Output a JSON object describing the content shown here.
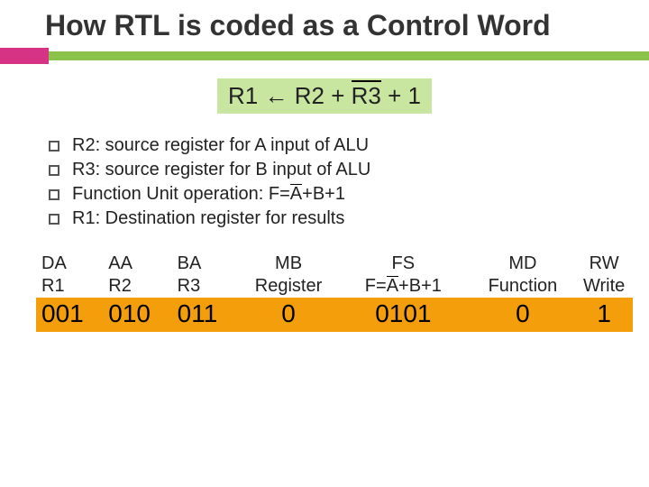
{
  "title": "How RTL is coded as a Control Word",
  "equation": {
    "lhs": "R1",
    "arrow": "←",
    "r2": "R2",
    "plus1": "+",
    "r3": "R3",
    "plus2": "+",
    "one": "1"
  },
  "bullets": {
    "b1": "R2: source register for A input of ALU",
    "b2": "R3: source register for B input of ALU",
    "b3_pre": "Function Unit operation: F=",
    "b3_a": "A",
    "b3_post": "+B+1",
    "b4": "R1: Destination register for results"
  },
  "table": {
    "headers": {
      "da": "DA",
      "aa": "AA",
      "ba": "BA",
      "mb": "MB",
      "fs": "FS",
      "md": "MD",
      "rw": "RW"
    },
    "sub": {
      "da": "R1",
      "aa": "R2",
      "ba": "R3",
      "mb": "Register",
      "fs_pre": "F=",
      "fs_a": "A",
      "fs_post": "+B+1",
      "md": "Function",
      "rw": "Write"
    },
    "codes": {
      "da": "001",
      "aa": "010",
      "ba": "011",
      "mb": "0",
      "fs": "0101",
      "md": "0",
      "rw": "1"
    }
  }
}
